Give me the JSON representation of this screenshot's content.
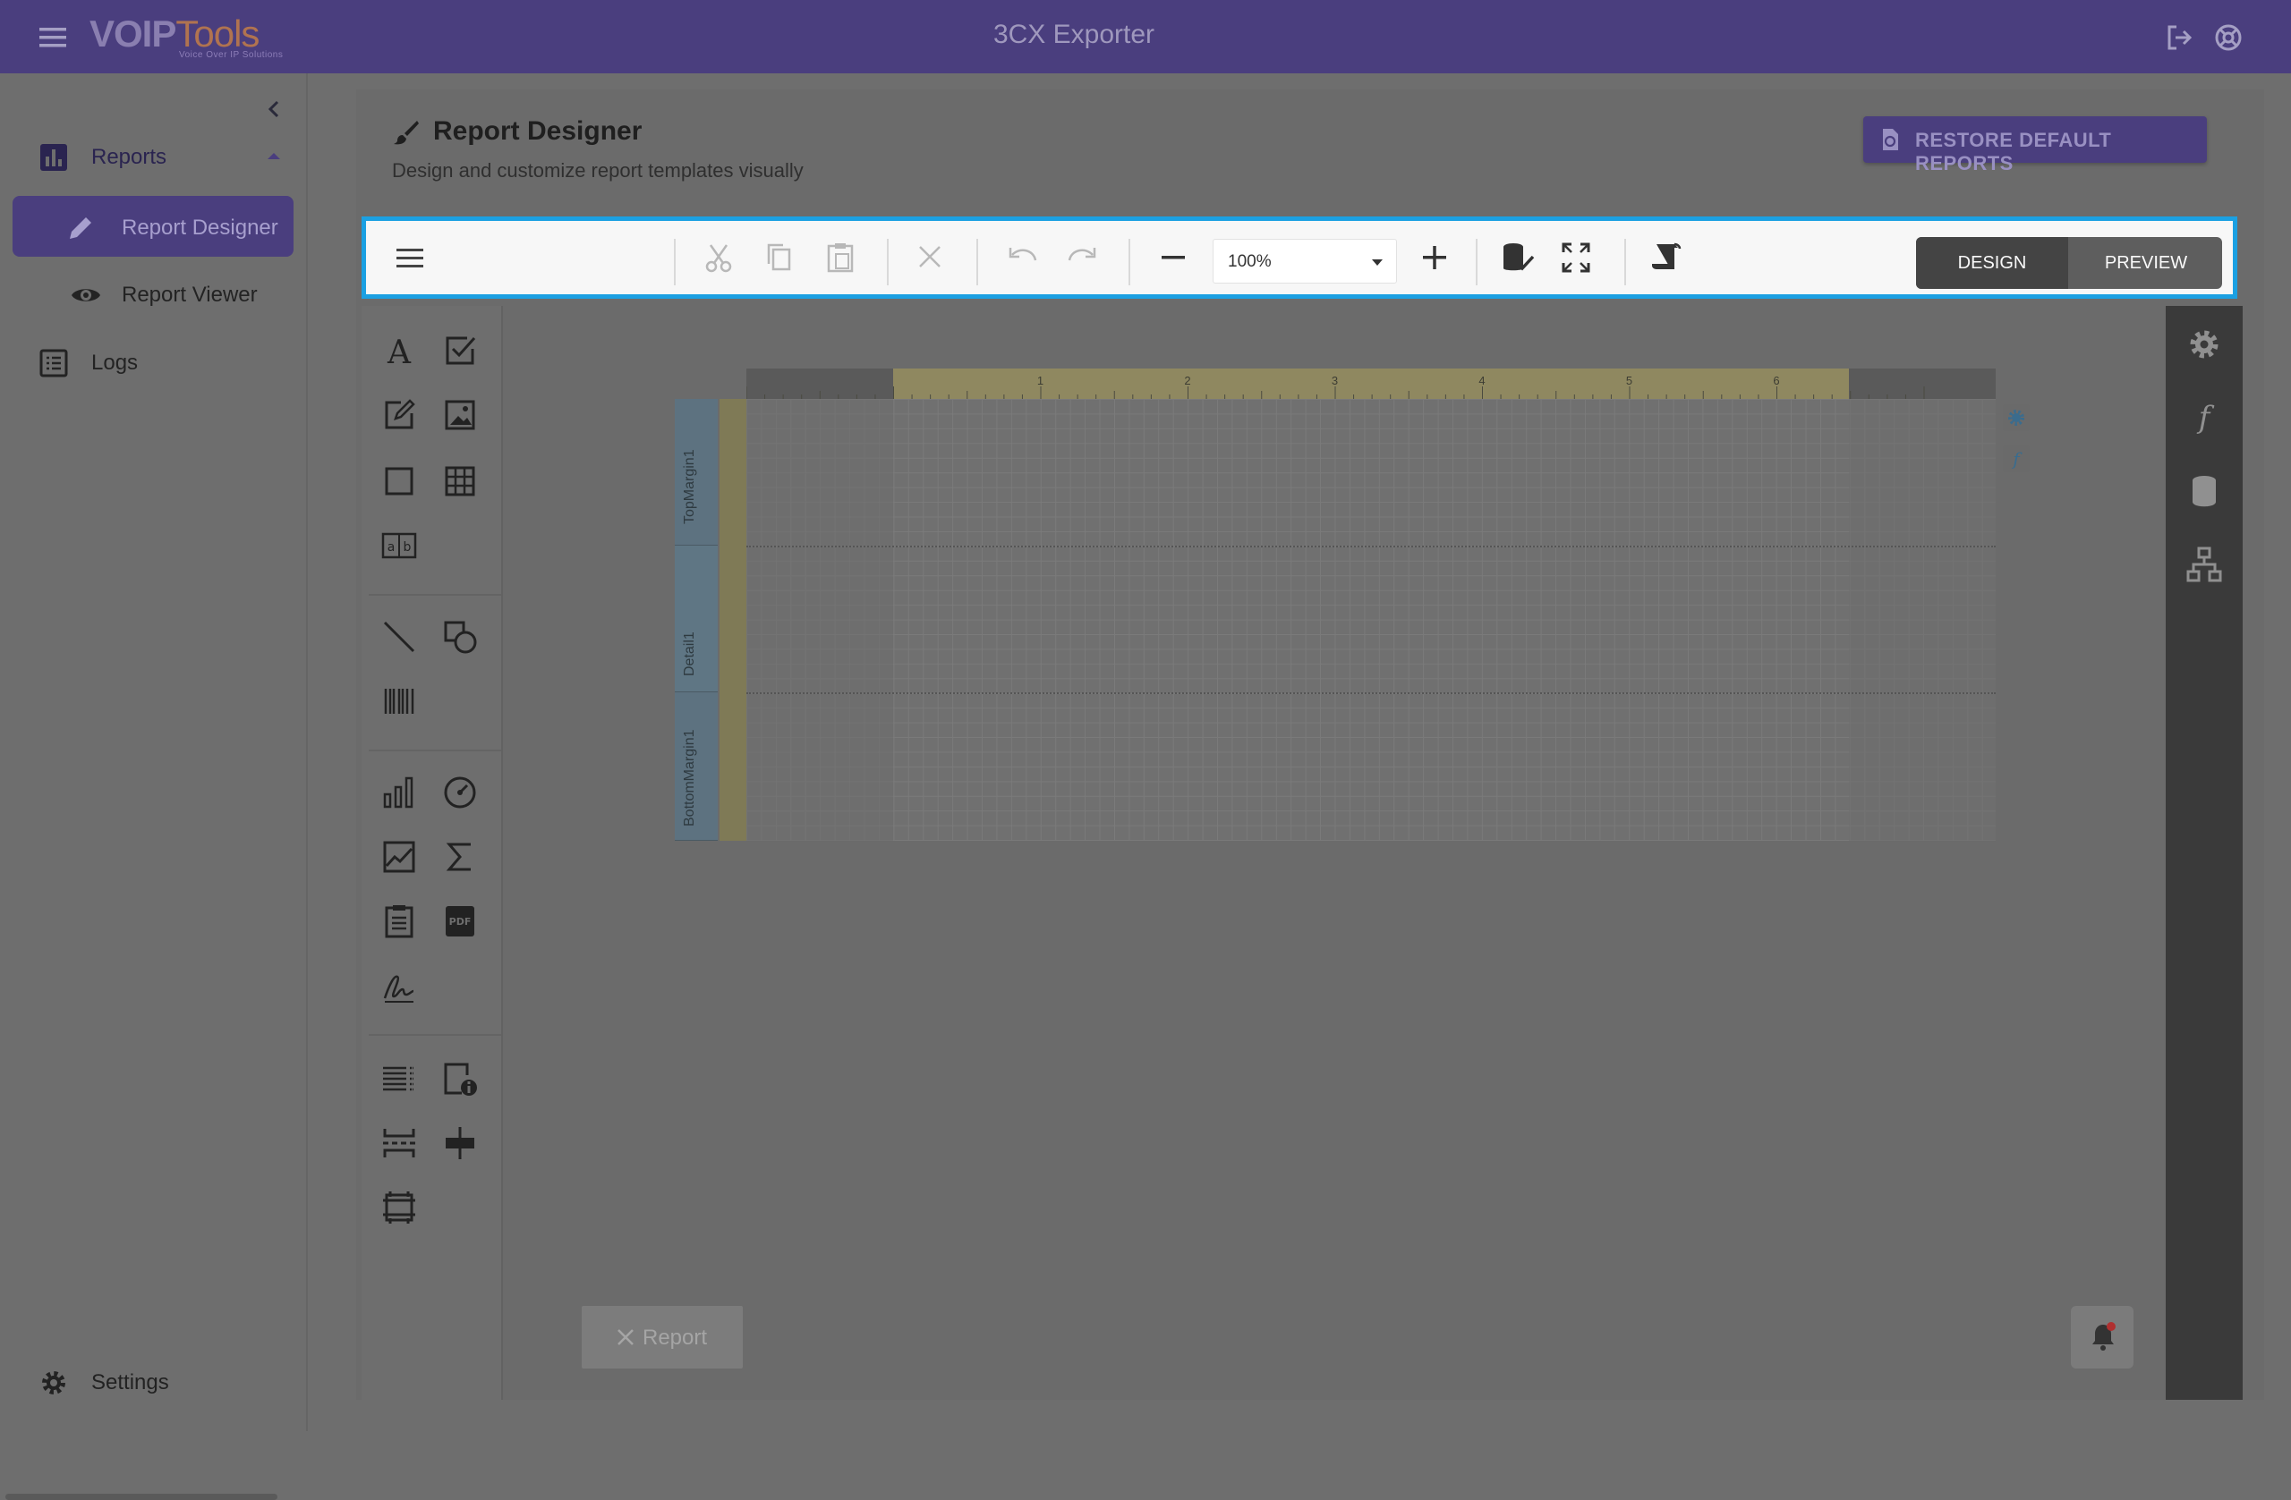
{
  "header": {
    "app_title": "3CX Exporter",
    "logo_main": "VOIP",
    "logo_tools": "Tools",
    "logo_tagline": "Voice Over IP Solutions",
    "icons": [
      "menu-icon",
      "logout-icon",
      "help-icon"
    ]
  },
  "sidebar": {
    "items": [
      {
        "label": "Reports",
        "icon": "bar-chart-icon"
      },
      {
        "label": "Report Designer",
        "icon": "pencil-icon"
      },
      {
        "label": "Report Viewer",
        "icon": "eye-icon"
      },
      {
        "label": "Logs",
        "icon": "list-icon"
      }
    ],
    "settings_label": "Settings"
  },
  "page": {
    "title": "Report Designer",
    "subtitle": "Design and customize report templates visually",
    "restore_button": "RESTORE DEFAULT REPORTS"
  },
  "toolbar": {
    "zoom_value": "100%",
    "design_label": "DESIGN",
    "preview_label": "PREVIEW"
  },
  "designer": {
    "bands": [
      "TopMargin1",
      "Detail1",
      "BottomMargin1"
    ],
    "ruler_ticks": [
      "1",
      "2",
      "3",
      "4",
      "5",
      "6"
    ],
    "report_tab_label": "Report"
  },
  "colors": {
    "brand": "#4a3e7e",
    "toolbar_highlight": "#1ba0e2",
    "overlay_gray": "#6e6e6e"
  }
}
